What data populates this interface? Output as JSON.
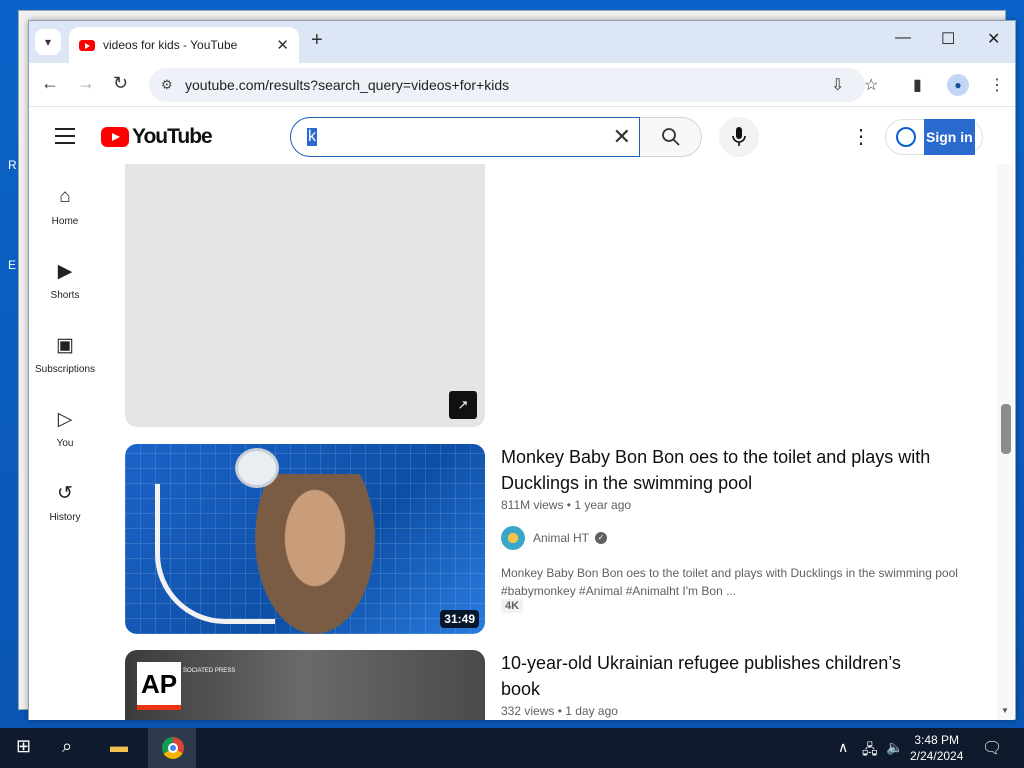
{
  "desktop": {
    "left_fragment": "R",
    "left_fragment2": "E"
  },
  "browser": {
    "tab_title": "videos for kids - YouTube",
    "tab_close": "✕",
    "new_tab": "+",
    "url": "youtube.com/results?search_query=videos+for+kids",
    "window_controls": {
      "minimize": "—",
      "maximize": "☐",
      "close": "✕"
    }
  },
  "youtube": {
    "logo_text": "YouTube",
    "search_value": "k",
    "signin_label": "Sign in",
    "sidebar": [
      {
        "icon": "home-icon",
        "label": "Home"
      },
      {
        "icon": "shorts-icon",
        "label": "Shorts"
      },
      {
        "icon": "subscriptions-icon",
        "label": "Subscriptions"
      },
      {
        "icon": "you-icon",
        "label": "You"
      },
      {
        "icon": "history-icon",
        "label": "History"
      }
    ],
    "results": [
      {
        "title": "Monkey Baby Bon Bon oes to the toilet and plays with Ducklings in the swimming pool",
        "meta": "811M views • 1 year ago",
        "channel": "Animal HT",
        "description": "Monkey Baby Bon Bon oes to the toilet and plays with Ducklings in the swimming pool #babymonkey #Animal #Animalht I'm Bon ...",
        "badge": "4K",
        "duration": "31:49"
      },
      {
        "title": "10-year-old Ukrainian refugee publishes children’s book",
        "meta": "332 views • 1 day ago",
        "thumb_logo": "AP",
        "thumb_logo_sub": "SOCIATED PRESS"
      }
    ]
  },
  "taskbar": {
    "time": "3:48 PM",
    "date": "2/24/2024"
  }
}
